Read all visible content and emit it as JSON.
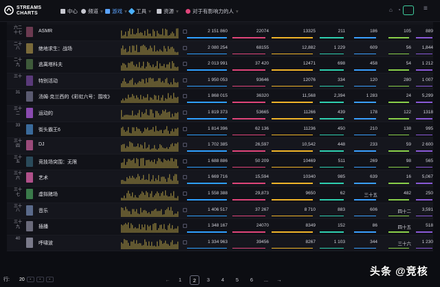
{
  "header": {
    "logo_line1": "STREAMS",
    "logo_line2": "CHARTS",
    "nav": [
      {
        "label": "中心",
        "icon": "grid-icon"
      },
      {
        "label": "频道",
        "icon": "channel-icon"
      },
      {
        "label": "游戏",
        "icon": "gamepad-icon",
        "active": true
      },
      {
        "label": "工具",
        "icon": "tools-icon"
      },
      {
        "label": "资源",
        "icon": "resources-icon"
      },
      {
        "label": "对于有影响力的人",
        "icon": "influencer-icon"
      }
    ],
    "right_icons": [
      "gift-icon",
      "bell-icon",
      "live-icon",
      "menu-icon"
    ]
  },
  "rows": [
    {
      "rank": "六二十七",
      "name": "ASMR",
      "c1": "2 151 860",
      "c2": "22074",
      "c3": "13325",
      "c4": "211",
      "c5": "186",
      "c6": "105",
      "c7": "889",
      "thumb": "#6b3a50"
    },
    {
      "rank": "二十八",
      "name": "绝地求生：战场",
      "c1": "2 080 254",
      "c2": "68155",
      "c3": "12,882",
      "c4": "1 229",
      "c5": "609",
      "c6": "56",
      "c7": "1,844",
      "thumb": "#7a6a3a"
    },
    {
      "rank": "二十九",
      "name": "逃离塔科夫",
      "c1": "2 013 991",
      "c2": "37 420",
      "c3": "12471",
      "c4": "698",
      "c5": "458",
      "c6": "54",
      "c7": "1 212",
      "thumb": "#3e5a3a"
    },
    {
      "rank": "三十",
      "name": "特别活动",
      "c1": "1 950 053",
      "c2": "93646",
      "c3": "12076",
      "c4": "334",
      "c5": "120",
      "c6": "280",
      "c7": "1 007",
      "thumb": "#5a3a7a"
    },
    {
      "rank": "31",
      "name": "汤姆·克兰西的《彩虹六号：围攻》",
      "c1": "1 868 015",
      "c2": "36320",
      "c3": "11,568",
      "c4": "2,394",
      "c5": "1 283",
      "c6": "24",
      "c7": "5,299",
      "thumb": "#5a5a70"
    },
    {
      "rank": "三十二",
      "name": "运动的",
      "c1": "1 819 373",
      "c2": "53665",
      "c3": "11266",
      "c4": "439",
      "c5": "178",
      "c6": "122",
      "c7": "1318",
      "thumb": "#8a4ab0"
    },
    {
      "rank": "33",
      "name": "街头霸王6",
      "c1": "1 814 396",
      "c2": "62 136",
      "c3": "11236",
      "c4": "450",
      "c5": "210",
      "c6": "138",
      "c7": "995",
      "thumb": "#3a6a9a"
    },
    {
      "rank": "三十四",
      "name": "DJ",
      "c1": "1 702 385",
      "c2": "26,597",
      "c3": "10,542",
      "c4": "448",
      "c5": "233",
      "c6": "59",
      "c7": "2 600",
      "thumb": "#9a4a7a"
    },
    {
      "rank": "三十五",
      "name": "竞技场突围：无限",
      "c1": "1 688 886",
      "c2": "50 209",
      "c3": "10469",
      "c4": "511",
      "c5": "269",
      "c6": "98",
      "c7": "565",
      "thumb": "#2a4a5a"
    },
    {
      "rank": "三十六",
      "name": "艺术",
      "c1": "1 669 716",
      "c2": "15,594",
      "c3": "10340",
      "c4": "985",
      "c5": "639",
      "c6": "16",
      "c7": "5,067",
      "thumb": "#b0508a"
    },
    {
      "rank": "三十七",
      "name": "虚拟赌场",
      "c1": "1 558 388",
      "c2": "29,873",
      "c3": "9650",
      "c4": "62",
      "c5": "三十五",
      "c6": "482",
      "c7": "250",
      "thumb": "#3a7a4a"
    },
    {
      "rank": "三十八",
      "name": "音乐",
      "c1": "1 406 517",
      "c2": "37 267",
      "c3": "8 710",
      "c4": "883",
      "c5": "606",
      "c6": "四十二",
      "c7": "3,591",
      "thumb": "#5a6a8a"
    },
    {
      "rank": "三十九",
      "name": "插播",
      "c1": "1 348 167",
      "c2": "24070",
      "c3": "8349",
      "c4": "152",
      "c5": "86",
      "c6": "四十五",
      "c7": "518",
      "thumb": "#6a6a7a"
    },
    {
      "rank": "40",
      "name": "呼啸波",
      "c1": "1 334 963",
      "c2": "39456",
      "c3": "8267",
      "c4": "1 103",
      "c5": "344",
      "c6": "三十六",
      "c7": "1 230",
      "thumb": "#7a7a8a"
    }
  ],
  "column_colors": {
    "c1": "#2fa0ff",
    "c2": "#e0457a",
    "c3": "#f0b429",
    "c4": "#2fd0b0",
    "c5": "#3aa0ff",
    "c6": "#8ad04a",
    "c7": "#8a5ad8"
  },
  "footer": {
    "rows_label": "行:",
    "rows_value": "20",
    "pages": [
      "1",
      "2",
      "3",
      "4",
      "5",
      "6",
      "..."
    ],
    "current_page": "2"
  },
  "watermark": "头条 @竞核"
}
